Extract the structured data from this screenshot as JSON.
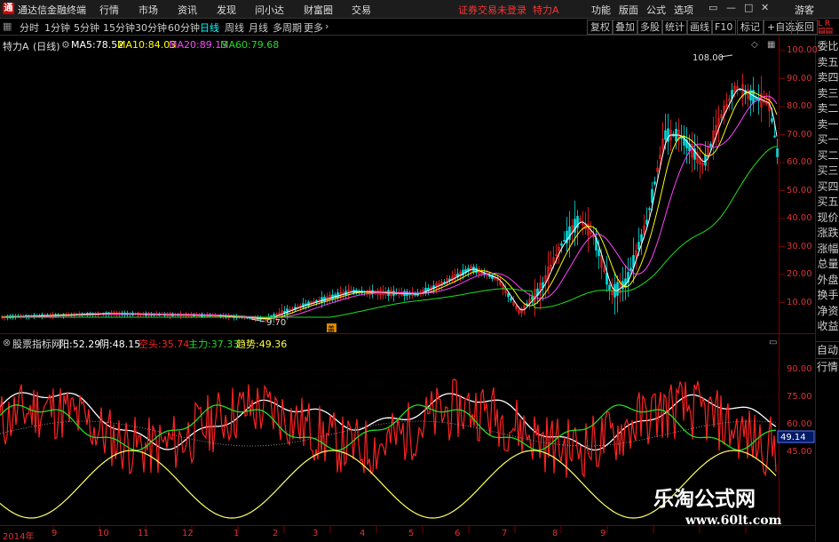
{
  "window": {
    "app_title": "通达信金融终端",
    "menus": [
      "行情",
      "市场",
      "资讯",
      "发现",
      "问小达",
      "财富圈",
      "交易"
    ],
    "login_status": "证券交易未登录",
    "stock_badge": "特力A",
    "right_menus": [
      "功能",
      "版面",
      "公式",
      "选项"
    ],
    "user": "游客"
  },
  "toolbar": {
    "periods": [
      "分时",
      "1分钟",
      "5分钟",
      "15分钟",
      "30分钟",
      "60分钟",
      "日线",
      "周线",
      "月线",
      "多周期",
      "更多"
    ],
    "active_period": "日线",
    "buttons": [
      "复权",
      "叠加",
      "多股",
      "统计",
      "画线",
      "F10",
      "标记",
      "+自选",
      "返回"
    ]
  },
  "main_chart": {
    "stock_name": "特力A",
    "period_tag": "(日线)",
    "ma": [
      {
        "label": "MA5:",
        "value": "78.52",
        "color": "#ffffff"
      },
      {
        "label": "MA10:",
        "value": "84.03",
        "color": "#ffff00"
      },
      {
        "label": "MA20:",
        "value": "89.13",
        "color": "#ff44ff"
      },
      {
        "label": "MA60:",
        "value": "79.68",
        "color": "#22dd22"
      }
    ],
    "high_label": "108.00",
    "low_label": "9.70",
    "y_ticks": [
      "100.00",
      "90.00",
      "80.00",
      "70.00",
      "60.00",
      "50.00",
      "40.00",
      "30.00",
      "20.00",
      "10.00"
    ]
  },
  "indicator": {
    "name": "股票指标网",
    "items": [
      {
        "label": "阳:",
        "value": "52.29",
        "color": "#ffffff"
      },
      {
        "label": "阴:",
        "value": "48.15",
        "color": "#ffffff"
      },
      {
        "label": "空头:",
        "value": "35.74",
        "color": "#ff2222"
      },
      {
        "label": "主力:",
        "value": "37.33",
        "color": "#22dd22"
      },
      {
        "label": "趋势:",
        "value": "49.36",
        "color": "#ffff44"
      }
    ],
    "y_ticks": [
      "90.00",
      "75.00",
      "60.00",
      "45.00"
    ],
    "current_value": "49.14"
  },
  "side_panel": {
    "labels": [
      "委比",
      "卖五",
      "卖四",
      "卖三",
      "卖二",
      "卖一",
      "买一",
      "买二",
      "买三",
      "买四",
      "买五",
      "现价",
      "涨跌",
      "涨幅",
      "总量",
      "外盘",
      "换手",
      "净资",
      "收益"
    ],
    "bottom_buttons": [
      "自动",
      "行情"
    ]
  },
  "x_axis": [
    "2014年",
    "9",
    "10",
    "11",
    "12",
    "1",
    "2",
    "3",
    "4",
    "5",
    "6",
    "7",
    "8",
    "9"
  ],
  "watermark": {
    "line1": "乐淘公式网",
    "line2": "www.60lt.com"
  },
  "colors": {
    "up": "#ff2222",
    "ma5": "#ffffff",
    "ma10": "#ffff00",
    "ma20": "#ff44ff",
    "ma60": "#22dd22"
  }
}
